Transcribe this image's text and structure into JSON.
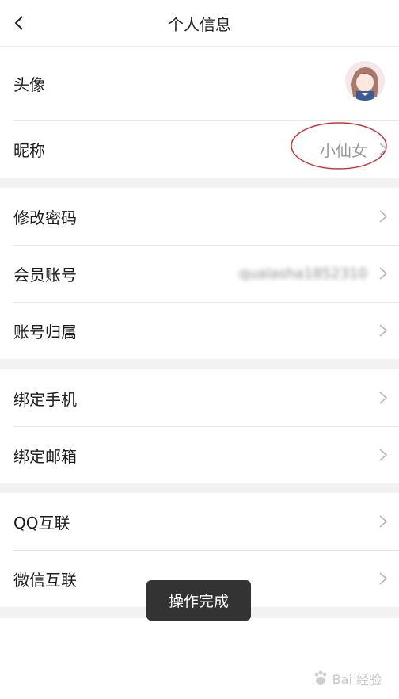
{
  "header": {
    "title": "个人信息"
  },
  "groups": [
    {
      "rows": [
        {
          "label": "头像"
        },
        {
          "label": "昵称",
          "value": "小仙女"
        }
      ]
    },
    {
      "rows": [
        {
          "label": "修改密码"
        },
        {
          "label": "会员账号",
          "value_masked": "qualasha1852310"
        },
        {
          "label": "账号归属"
        }
      ]
    },
    {
      "rows": [
        {
          "label": "绑定手机"
        },
        {
          "label": "绑定邮箱"
        }
      ]
    },
    {
      "rows": [
        {
          "label": "QQ互联"
        },
        {
          "label": "微信互联"
        }
      ]
    }
  ],
  "toast": {
    "text": "操作完成"
  },
  "watermark": {
    "text": "Bai 经验"
  },
  "colors": {
    "accent_red": "#cc2f2f",
    "toast_bg": "#333333"
  }
}
